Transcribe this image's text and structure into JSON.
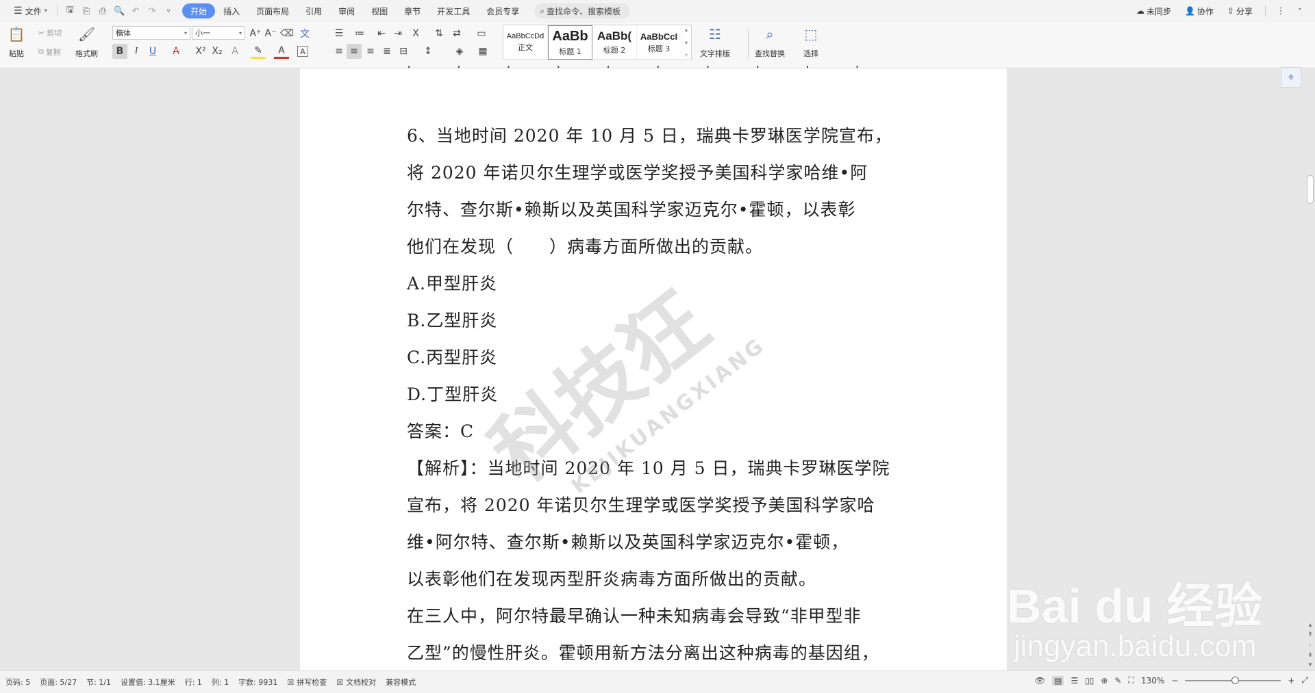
{
  "menubar": {
    "file_label": "文件",
    "tabs": [
      "开始",
      "插入",
      "页面布局",
      "引用",
      "审阅",
      "视图",
      "章节",
      "开发工具",
      "会员专享"
    ],
    "active_tab": "开始",
    "search_placeholder": "查找命令、搜索模板",
    "right": {
      "sync": "未同步",
      "collab": "协作",
      "share": "分享"
    }
  },
  "ribbon": {
    "paste": "粘贴",
    "cut": "剪切",
    "copy": "复制",
    "format_painter": "格式刷",
    "font_name": "楷体",
    "font_size": "小一",
    "styles": [
      {
        "preview": "AaBbCcDd",
        "name": "正文"
      },
      {
        "preview": "AaBb",
        "name": "标题 1"
      },
      {
        "preview": "AaBb(",
        "name": "标题 2"
      },
      {
        "preview": "AaBbCcI",
        "name": "标题 3"
      }
    ],
    "text_layout": "文字排版",
    "find_replace": "查找替换",
    "select": "选择"
  },
  "document": {
    "lines": [
      "6、当地时间 2020 年 10 月 5 日，瑞典卡罗琳医学院宣布，",
      "将 2020 年诺贝尔生理学或医学奖授予美国科学家哈维•阿",
      "尔特、查尔斯•赖斯以及英国科学家迈克尔•霍顿，以表彰",
      "他们在发现（　　）病毒方面所做出的贡献。",
      "A.甲型肝炎",
      "B.乙型肝炎",
      "C.丙型肝炎",
      "D.丁型肝炎",
      "答案：C",
      "【解析】：当地时间 2020 年 10 月 5 日，瑞典卡罗琳医学院",
      "宣布，将 2020 年诺贝尔生理学或医学奖授予美国科学家哈",
      "维•阿尔特、查尔斯•赖斯以及英国科学家迈克尔•霍顿，",
      "以表彰他们在发现丙型肝炎病毒方面所做出的贡献。",
      "在三人中，阿尔特最早确认一种未知病毒会导致“非甲型非",
      "乙型”的慢性肝炎。霍顿用新方法分离出这种病毒的基因组，"
    ],
    "watermark_big": "科技狂",
    "watermark_small": "KEJIKUANGXIANG"
  },
  "baidu_watermark": {
    "logo": "Bai du 经验",
    "url": "jingyan.baidu.com"
  },
  "statusbar": {
    "page_code": "页码: 5",
    "pages": "页面: 5/27",
    "section": "节: 1/1",
    "setting": "设置值: 3.1厘米",
    "row": "行: 1",
    "col": "列: 1",
    "word_count": "字数: 9931",
    "spell_check": "拼写检查",
    "doc_check": "文档校对",
    "compat_mode": "兼容模式",
    "zoom": "130%",
    "zoom_level": 0.52
  },
  "colors": {
    "accent": "#5a8ef0",
    "page_bg": "#e7e7e7",
    "toolbar_bg": "#f7f7f7"
  }
}
